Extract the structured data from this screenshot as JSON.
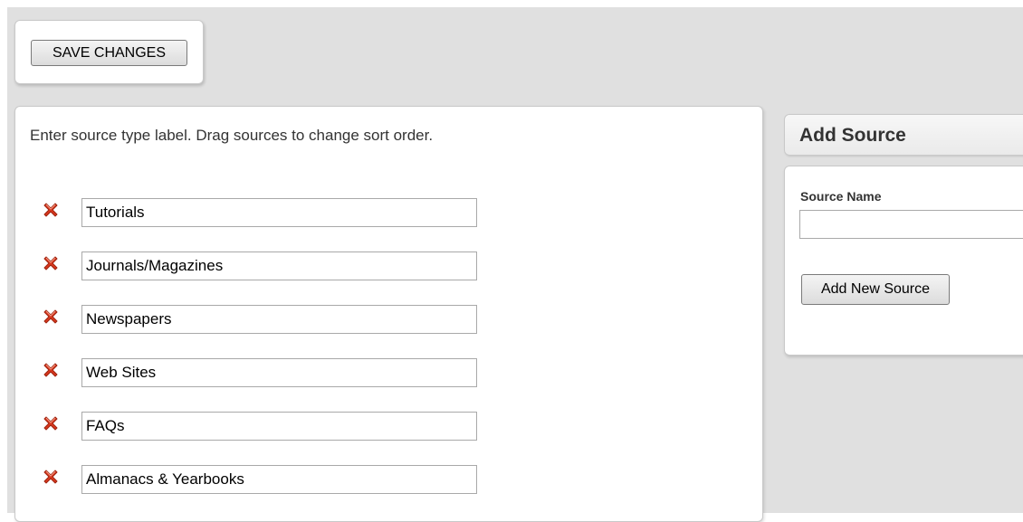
{
  "toolbar": {
    "save_label": "SAVE CHANGES"
  },
  "sources_panel": {
    "instructions": "Enter source type label. Drag sources to change sort order.",
    "delete_icon": "red-x-delete-icon",
    "items": [
      {
        "value": "Tutorials"
      },
      {
        "value": "Journals/Magazines"
      },
      {
        "value": "Newspapers"
      },
      {
        "value": "Web Sites"
      },
      {
        "value": "FAQs"
      },
      {
        "value": "Almanacs & Yearbooks"
      }
    ]
  },
  "add_source": {
    "title": "Add Source",
    "field_label": "Source Name",
    "field_value": "",
    "button_label": "Add New Source"
  },
  "colors": {
    "background": "#e0e0e0",
    "panel": "#ffffff",
    "delete_icon": "#d9381e"
  }
}
